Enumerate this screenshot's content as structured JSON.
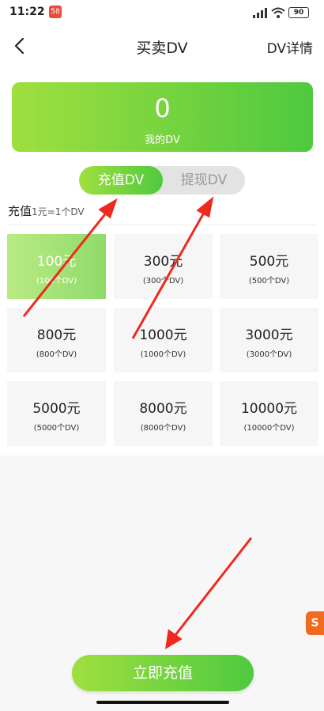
{
  "status_bar": {
    "time": "11:22",
    "app_badge": "58",
    "battery": "90"
  },
  "header": {
    "title": "买卖DV",
    "detail_link": "DV详情"
  },
  "balance": {
    "value": "0",
    "label": "我的DV"
  },
  "tabs": [
    {
      "label": "充值DV",
      "active": true
    },
    {
      "label": "提现DV",
      "active": false
    }
  ],
  "rate": {
    "title": "充值",
    "subtitle": "1元=1个DV"
  },
  "options": [
    {
      "amount": "100元",
      "dv": "(100个DV)",
      "selected": true
    },
    {
      "amount": "300元",
      "dv": "(300个DV)",
      "selected": false
    },
    {
      "amount": "500元",
      "dv": "(500个DV)",
      "selected": false
    },
    {
      "amount": "800元",
      "dv": "(800个DV)",
      "selected": false
    },
    {
      "amount": "1000元",
      "dv": "(1000个DV)",
      "selected": false
    },
    {
      "amount": "3000元",
      "dv": "(3000个DV)",
      "selected": false
    },
    {
      "amount": "5000元",
      "dv": "(5000个DV)",
      "selected": false
    },
    {
      "amount": "8000元",
      "dv": "(8000个DV)",
      "selected": false
    },
    {
      "amount": "10000元",
      "dv": "(10000个DV)",
      "selected": false
    }
  ],
  "floating_icon": {
    "label": "S"
  },
  "submit_button": {
    "label": "立即充值"
  },
  "colors": {
    "accent_start": "#9fdf3f",
    "accent_end": "#4fc93f",
    "annotation_arrow": "#ee2a1f"
  },
  "icons": {
    "back": "chevron-left-icon",
    "signal": "signal-icon",
    "wifi": "wifi-icon",
    "battery": "battery-icon"
  }
}
